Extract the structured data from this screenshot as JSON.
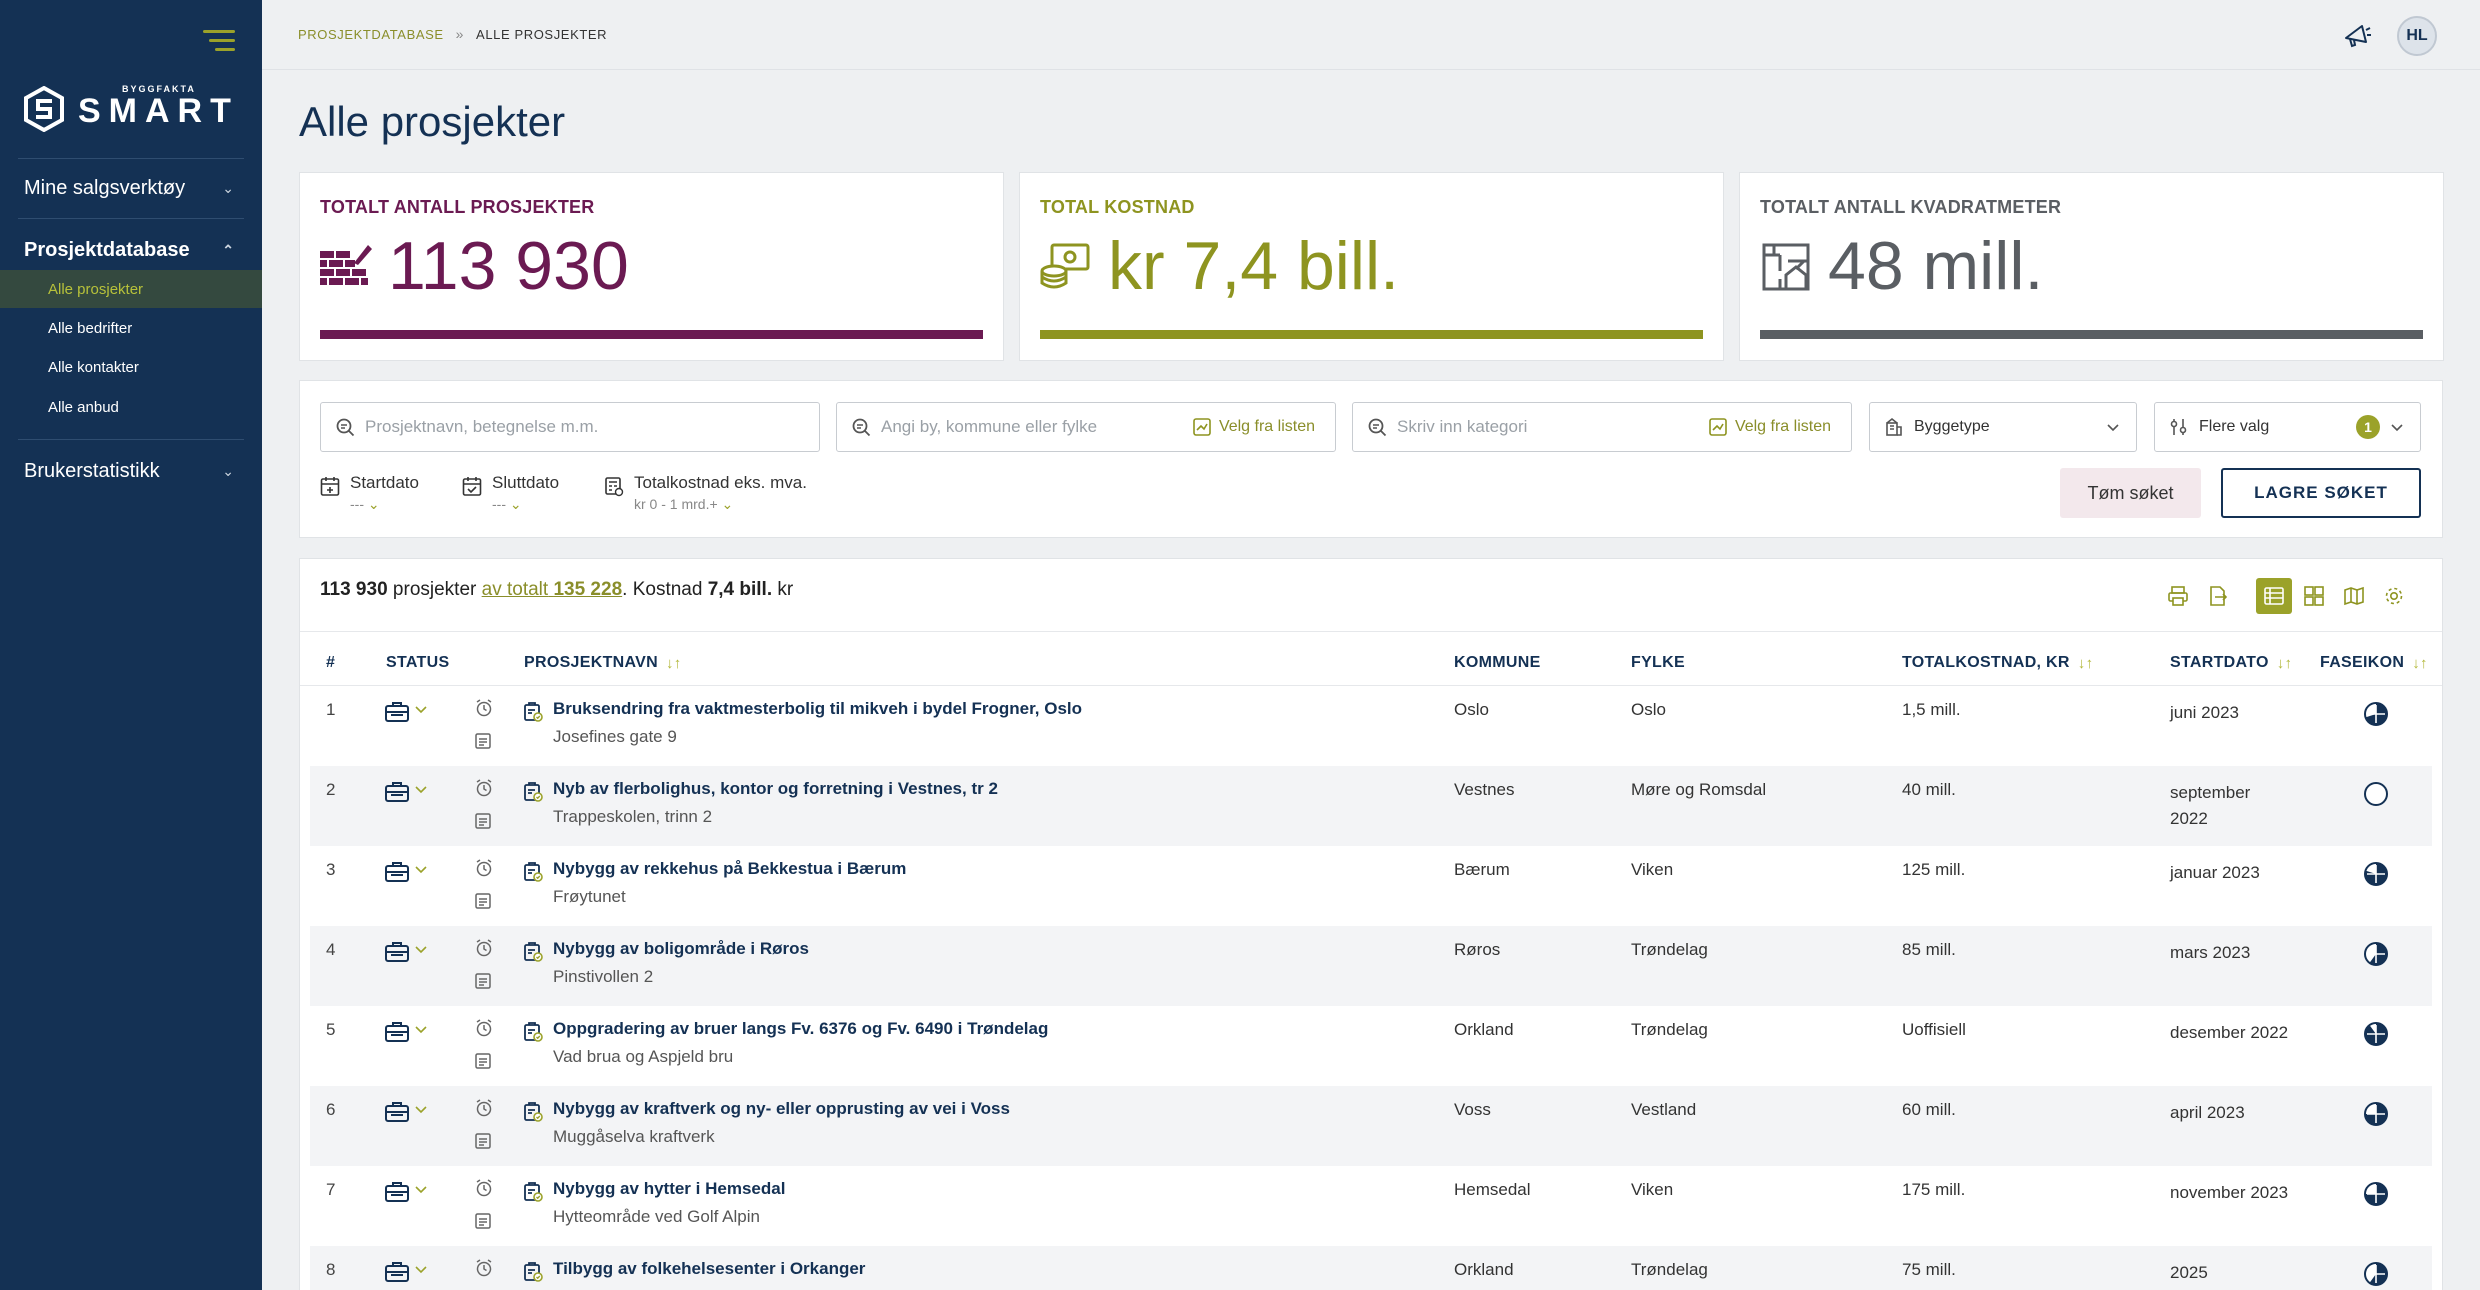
{
  "sidebar": {
    "logo_small": "BYGGFAKTA",
    "logo_main": "SMART",
    "sections": [
      {
        "label": "Mine salgsverktøy"
      },
      {
        "label": "Prosjektdatabase"
      },
      {
        "label": "Brukerstatistikk"
      }
    ],
    "subitems": [
      {
        "label": "Alle prosjekter"
      },
      {
        "label": "Alle bedrifter"
      },
      {
        "label": "Alle kontakter"
      },
      {
        "label": "Alle anbud"
      }
    ]
  },
  "breadcrumb": {
    "parent": "PROSJEKTDATABASE",
    "separator": "»",
    "current": "ALLE PROSJEKTER"
  },
  "user": {
    "initials": "HL"
  },
  "page_title": "Alle prosjekter",
  "kpis": [
    {
      "label": "TOTALT ANTALL PROSJEKTER",
      "value": "113 930",
      "color": "#6b1a52",
      "icon": "brick-wall-icon"
    },
    {
      "label": "TOTAL KOSTNAD",
      "value": "kr 7,4 bill.",
      "color": "#8e9420",
      "icon": "money-icon"
    },
    {
      "label": "TOTALT ANTALL KVADRATMETER",
      "value": "48 mill.",
      "color": "#5a5e63",
      "icon": "floorplan-icon"
    }
  ],
  "filters": {
    "search_placeholder": "Prosjektnavn, betegnelse m.m.",
    "location_placeholder": "Angi by, kommune eller fylke",
    "category_placeholder": "Skriv inn kategori",
    "pick_from_list": "Velg fra listen",
    "building_type": "Byggetype",
    "more_options": "Flere valg",
    "more_options_count": "1",
    "start_date_label": "Startdato",
    "start_date_value": "---",
    "end_date_label": "Sluttdato",
    "end_date_value": "---",
    "cost_label": "Totalkostnad eks. mva.",
    "cost_value": "kr 0 - 1 mrd.+",
    "clear_button": "Tøm søket",
    "save_button": "LAGRE SØKET"
  },
  "summary": {
    "count": "113 930",
    "text_projects": "prosjekter",
    "of_total": "av totalt",
    "total": "135 228",
    "cost_label": ". Kostnad",
    "cost": "7,4 bill.",
    "currency": "kr"
  },
  "table": {
    "headers": {
      "num": "#",
      "status": "STATUS",
      "name": "PROSJEKTNAVN",
      "municipality": "KOMMUNE",
      "county": "FYLKE",
      "cost": "TOTALKOSTNAD, KR",
      "start": "STARTDATO",
      "phase": "FASEIKON"
    },
    "rows": [
      {
        "num": "1",
        "name": "Bruksendring fra vaktmesterbolig til mikveh i bydel Frogner, Oslo",
        "sub": "Josefines gate 9",
        "municipality": "Oslo",
        "county": "Oslo",
        "cost": "1,5 mill.",
        "start": "juni 2023"
      },
      {
        "num": "2",
        "name": "Nyb av flerbolighus, kontor og forretning i Vestnes, tr 2",
        "sub": "Trappeskolen, trinn 2",
        "municipality": "Vestnes",
        "county": "Møre og Romsdal",
        "cost": "40 mill.",
        "start": "september 2022"
      },
      {
        "num": "3",
        "name": "Nybygg av rekkehus på Bekkestua i Bærum",
        "sub": "Frøytunet",
        "municipality": "Bærum",
        "county": "Viken",
        "cost": "125 mill.",
        "start": "januar 2023"
      },
      {
        "num": "4",
        "name": "Nybygg av boligområde i Røros",
        "sub": "Pinstivollen 2",
        "municipality": "Røros",
        "county": "Trøndelag",
        "cost": "85 mill.",
        "start": "mars 2023"
      },
      {
        "num": "5",
        "name": "Oppgradering av bruer langs Fv. 6376 og Fv. 6490 i Trøndelag",
        "sub": "Vad brua og Aspjeld bru",
        "municipality": "Orkland",
        "county": "Trøndelag",
        "cost": "Uoffisiell",
        "start": "desember 2022"
      },
      {
        "num": "6",
        "name": "Nybygg av kraftverk og ny- eller opprusting av vei i Voss",
        "sub": "Muggåselva kraftverk",
        "municipality": "Voss",
        "county": "Vestland",
        "cost": "60 mill.",
        "start": "april 2023"
      },
      {
        "num": "7",
        "name": "Nybygg av hytter i Hemsedal",
        "sub": "Hytteområde ved Golf Alpin",
        "municipality": "Hemsedal",
        "county": "Viken",
        "cost": "175 mill.",
        "start": "november 2023"
      },
      {
        "num": "8",
        "name": "Tilbygg av folkehelsesenter i Orkanger",
        "sub": "",
        "municipality": "Orkland",
        "county": "Trøndelag",
        "cost": "75 mill.",
        "start": "2025"
      }
    ]
  }
}
